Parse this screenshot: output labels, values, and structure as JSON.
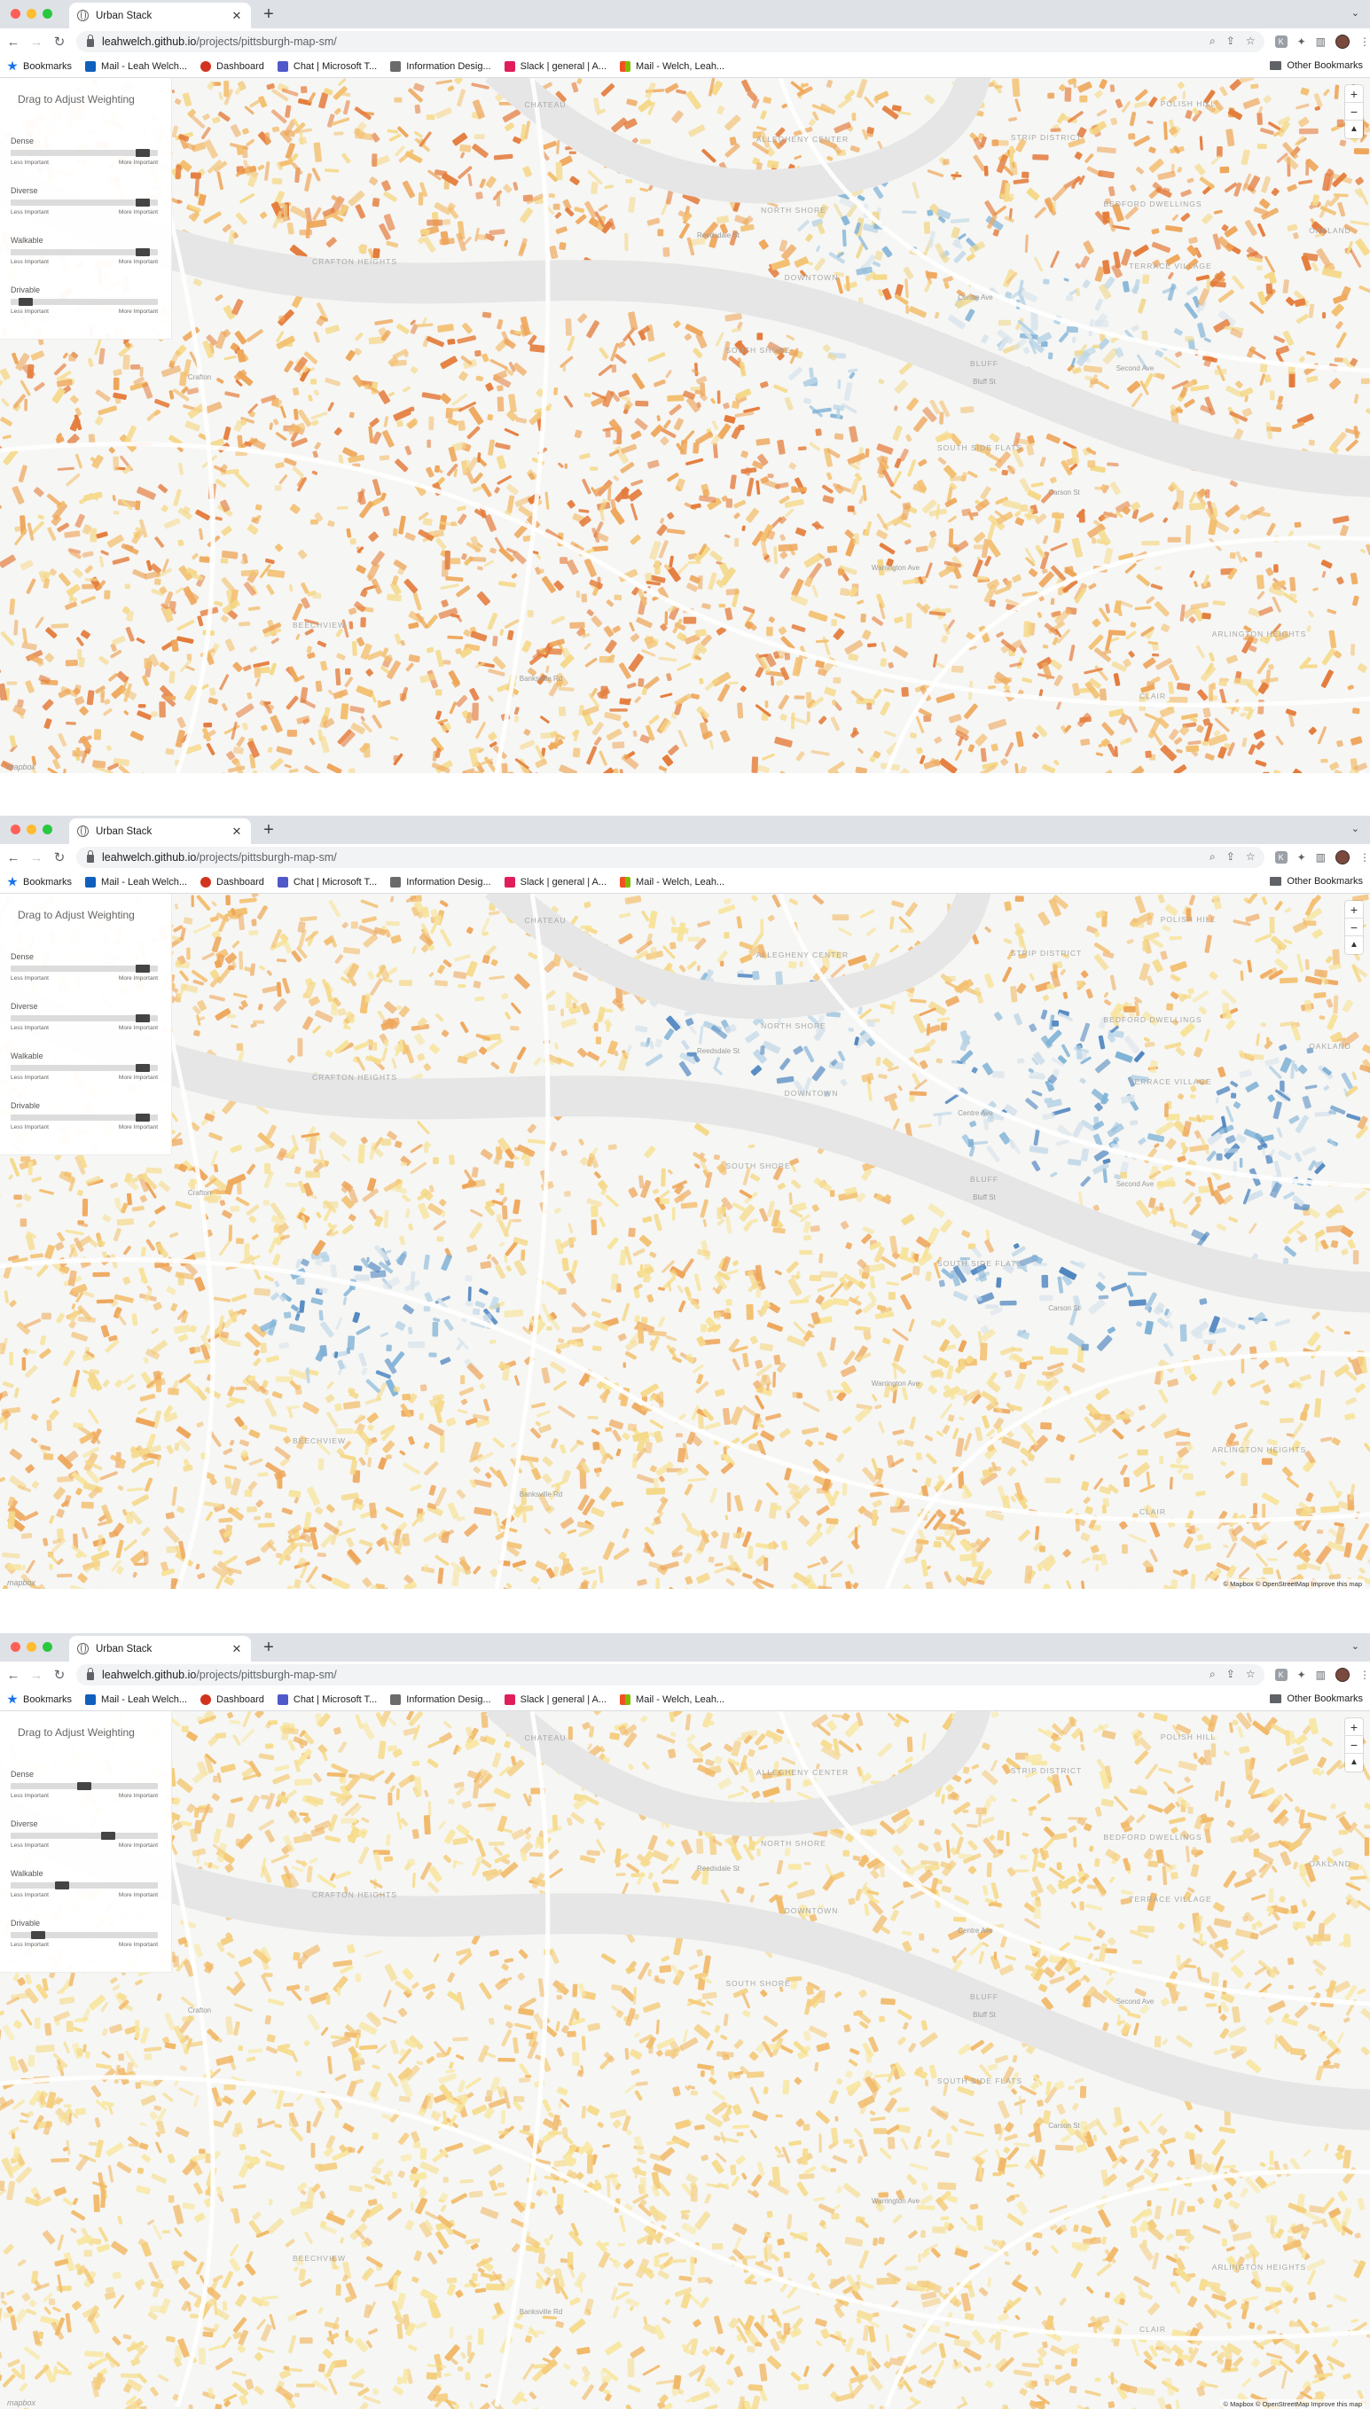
{
  "screenshots": [
    {
      "browser": {
        "tab_title": "Urban Stack",
        "url_host": "leahwelch.github.io",
        "url_path": "/projects/pittsburgh-map-sm/",
        "bookmarks": [
          {
            "label": "Bookmarks",
            "icon": "star-icon",
            "color": "#1a73e8"
          },
          {
            "label": "Mail - Leah Welch...",
            "icon": "outlook-icon",
            "color": "#0f5fbd"
          },
          {
            "label": "Dashboard",
            "icon": "dashboard-icon",
            "color": "#d2331f"
          },
          {
            "label": "Chat | Microsoft T...",
            "icon": "teams-icon",
            "color": "#5059c9"
          },
          {
            "label": "Information Desig...",
            "icon": "document-icon",
            "color": "#6b6b6b"
          },
          {
            "label": "Slack | general | A...",
            "icon": "slack-icon",
            "color": "#e01e5a"
          },
          {
            "label": "Mail - Welch, Leah...",
            "icon": "office-icon",
            "color": "#f25022"
          }
        ],
        "other_bookmarks": "Other Bookmarks"
      },
      "panel": {
        "title": "Drag to Adjust Weighting",
        "sliders": [
          {
            "label": "Dense",
            "value": 0.94,
            "min_label": "Less Important",
            "max_label": "More Important"
          },
          {
            "label": "Diverse",
            "value": 0.94,
            "min_label": "Less Important",
            "max_label": "More Important"
          },
          {
            "label": "Walkable",
            "value": 0.94,
            "min_label": "Less Important",
            "max_label": "More Important"
          },
          {
            "label": "Drivable",
            "value": 0.06,
            "min_label": "Less Important",
            "max_label": "More Important"
          }
        ]
      },
      "map": {
        "palette": [
          "#f5d98a",
          "#f3c071",
          "#eea65a",
          "#e47c3c",
          "#f0d890",
          "#d9e4ec",
          "#b7d3e6",
          "#7fb2d6"
        ],
        "attribution": ""
      }
    },
    {
      "browser": {
        "tab_title": "Urban Stack",
        "url_host": "leahwelch.github.io",
        "url_path": "/projects/pittsburgh-map-sm/",
        "bookmarks": [
          {
            "label": "Bookmarks",
            "icon": "star-icon",
            "color": "#1a73e8"
          },
          {
            "label": "Mail - Leah Welch...",
            "icon": "outlook-icon",
            "color": "#0f5fbd"
          },
          {
            "label": "Dashboard",
            "icon": "dashboard-icon",
            "color": "#d2331f"
          },
          {
            "label": "Chat | Microsoft T...",
            "icon": "teams-icon",
            "color": "#5059c9"
          },
          {
            "label": "Information Desig...",
            "icon": "document-icon",
            "color": "#6b6b6b"
          },
          {
            "label": "Slack | general | A...",
            "icon": "slack-icon",
            "color": "#e01e5a"
          },
          {
            "label": "Mail - Welch, Leah...",
            "icon": "office-icon",
            "color": "#f25022"
          }
        ],
        "other_bookmarks": "Other Bookmarks"
      },
      "panel": {
        "title": "Drag to Adjust Weighting",
        "sliders": [
          {
            "label": "Dense",
            "value": 0.94,
            "min_label": "Less Important",
            "max_label": "More Important"
          },
          {
            "label": "Diverse",
            "value": 0.94,
            "min_label": "Less Important",
            "max_label": "More Important"
          },
          {
            "label": "Walkable",
            "value": 0.94,
            "min_label": "Less Important",
            "max_label": "More Important"
          },
          {
            "label": "Drivable",
            "value": 0.94,
            "min_label": "Less Important",
            "max_label": "More Important"
          }
        ]
      },
      "map": {
        "palette": [
          "#f7e39a",
          "#f5d98a",
          "#f3c071",
          "#eea65a",
          "#d9e4ec",
          "#b7d3e6",
          "#7fb2d6",
          "#4f86c0"
        ],
        "attribution": "© Mapbox © OpenStreetMap Improve this map"
      }
    },
    {
      "browser": {
        "tab_title": "Urban Stack",
        "url_host": "leahwelch.github.io",
        "url_path": "/projects/pittsburgh-map-sm/",
        "bookmarks": [
          {
            "label": "Bookmarks",
            "icon": "star-icon",
            "color": "#1a73e8"
          },
          {
            "label": "Mail - Leah Welch...",
            "icon": "outlook-icon",
            "color": "#0f5fbd"
          },
          {
            "label": "Dashboard",
            "icon": "dashboard-icon",
            "color": "#d2331f"
          },
          {
            "label": "Chat | Microsoft T...",
            "icon": "teams-icon",
            "color": "#5059c9"
          },
          {
            "label": "Information Desig...",
            "icon": "document-icon",
            "color": "#6b6b6b"
          },
          {
            "label": "Slack | general | A...",
            "icon": "slack-icon",
            "color": "#e01e5a"
          },
          {
            "label": "Mail - Welch, Leah...",
            "icon": "office-icon",
            "color": "#f25022"
          }
        ],
        "other_bookmarks": "Other Bookmarks"
      },
      "panel": {
        "title": "Drag to Adjust Weighting",
        "sliders": [
          {
            "label": "Dense",
            "value": 0.5,
            "min_label": "Less Important",
            "max_label": "More Important"
          },
          {
            "label": "Diverse",
            "value": 0.68,
            "min_label": "Less Important",
            "max_label": "More Important"
          },
          {
            "label": "Walkable",
            "value": 0.33,
            "min_label": "Less Important",
            "max_label": "More Important"
          },
          {
            "label": "Drivable",
            "value": 0.15,
            "min_label": "Less Important",
            "max_label": "More Important"
          }
        ]
      },
      "map": {
        "palette": [
          "#f8e7a2",
          "#f6dc8e",
          "#f4cc7c",
          "#f1b968",
          "#eea65a",
          "#f7e7b0",
          "#f3d38a",
          "#efc47b"
        ],
        "attribution": "© Mapbox © OpenStreetMap Improve this map"
      }
    }
  ],
  "map_labels": [
    "CHATEAU",
    "ALLEGHENY CENTER",
    "NORTH SHORE",
    "DOWNTOWN",
    "STRIP DISTRICT",
    "POLISH HILL",
    "BEDFORD DWELLINGS",
    "TERRACE VILLAGE",
    "BLUFF",
    "SOUTH SHORE",
    "SOUTH SIDE FLATS",
    "ARLINGTON HEIGHTS",
    "CLAIR",
    "CRAFTON HEIGHTS",
    "OAKLAND",
    "BEECHVIEW",
    "Crafton",
    "Reedsdale St",
    "Centre Ave",
    "Bluff St",
    "Second Ave",
    "Carson St",
    "Warrington Ave",
    "Banksville Rd"
  ]
}
